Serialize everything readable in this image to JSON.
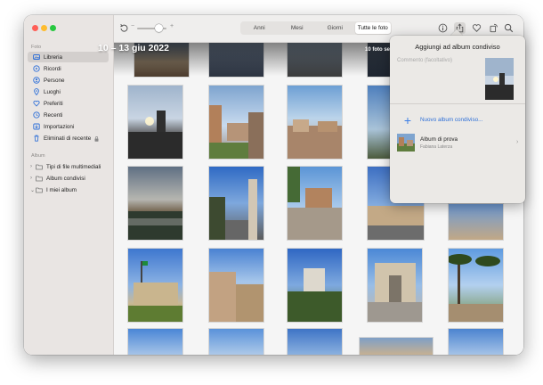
{
  "sidebar": {
    "section_photos": "Foto",
    "items": [
      {
        "label": "Libreria",
        "icon": "photo-library-icon"
      },
      {
        "label": "Ricordi",
        "icon": "memories-icon"
      },
      {
        "label": "Persone",
        "icon": "people-icon"
      },
      {
        "label": "Luoghi",
        "icon": "places-icon"
      },
      {
        "label": "Preferiti",
        "icon": "heart-icon"
      },
      {
        "label": "Recenti",
        "icon": "clock-icon"
      },
      {
        "label": "Importazioni",
        "icon": "import-icon"
      },
      {
        "label": "Eliminati di recente",
        "icon": "trash-icon"
      }
    ],
    "section_albums": "Album",
    "album_items": [
      {
        "label": "Tipi di file multimediali"
      },
      {
        "label": "Album condivisi"
      },
      {
        "label": "I miei album"
      }
    ]
  },
  "toolbar": {
    "zoom_minus": "−",
    "zoom_plus": "+",
    "segments": [
      "Anni",
      "Mesi",
      "Giorni",
      "Tutte le foto"
    ],
    "active_segment": "Tutte le foto"
  },
  "library": {
    "date_range": "10 – 13 giu 2022",
    "count_label": "10 foto se"
  },
  "popover": {
    "title": "Aggiungi ad album condiviso",
    "comment_placeholder": "Commento (facoltativo)",
    "new_album": "Nuovo album condiviso...",
    "album_name": "Album di prova",
    "album_owner": "Fabiana Laterza"
  },
  "colors": {
    "accent": "#2d6fd8",
    "sidebar_bg": "#e9e5e3",
    "selected_row": "#d3cfcd"
  }
}
